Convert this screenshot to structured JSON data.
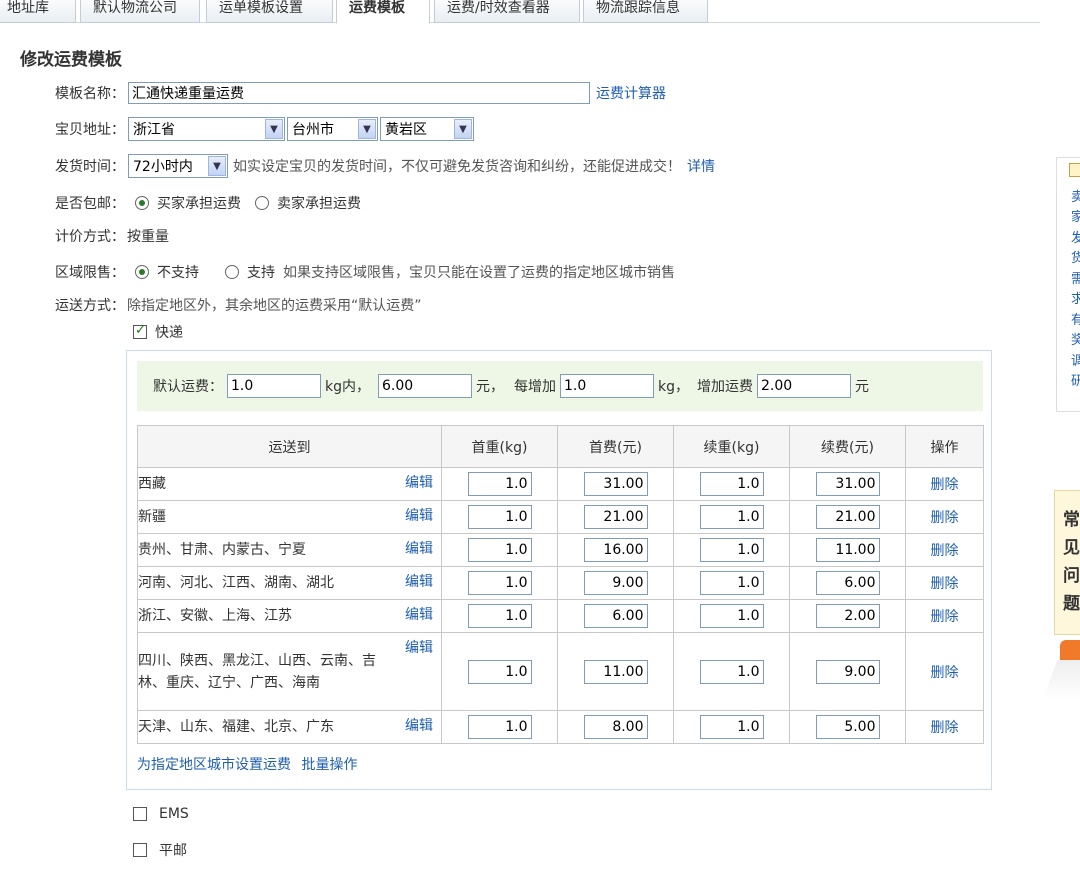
{
  "tabs": [
    "地址库",
    "默认物流公司",
    "运单模板设置",
    "运费模板",
    "运费/时效查看器",
    "物流跟踪信息"
  ],
  "page_title": "修改运费模板",
  "form": {
    "name_label": "模板名称：",
    "name_value": "汇通快递重量运费",
    "calc_link": "运费计算器",
    "address_label": "宝贝地址：",
    "province": "浙江省",
    "city": "台州市",
    "district": "黄岩区",
    "ship_time_label": "发货时间：",
    "ship_time": "72小时内",
    "ship_time_hint": "如实设定宝贝的发货时间，不仅可避免发货咨询和纠纷，还能促进成交！",
    "details_link": "详情",
    "free_ship_label": "是否包邮：",
    "free_ship_options": [
      "买家承担运费",
      "卖家承担运费"
    ],
    "pricing_label": "计价方式：",
    "pricing_value": "按重量",
    "region_label": "区域限售：",
    "region_options": [
      "不支持",
      "支持"
    ],
    "region_hint": "如果支持区域限售，宝贝只能在设置了运费的指定地区城市销售",
    "delivery_label": "运送方式：",
    "delivery_hint": "除指定地区外，其余地区的运费采用“默认运费”"
  },
  "express": {
    "label": "快递",
    "default_fee": {
      "label": "默认运费：",
      "weight": "1.0",
      "weight_unit": "kg内，",
      "fee": "6.00",
      "fee_unit": "元，",
      "per_add_label": "每增加",
      "add_weight": "1.0",
      "add_weight_unit": "kg，",
      "add_fee_label": "增加运费",
      "add_fee": "2.00",
      "add_fee_unit": "元"
    },
    "table": {
      "headers": [
        "运送到",
        "首重(kg)",
        "首费(元)",
        "续重(kg)",
        "续费(元)",
        "操作"
      ],
      "edit_label": "编辑",
      "delete_label": "删除",
      "rows": [
        {
          "dest": "西藏",
          "first_weight": "1.0",
          "first_fee": "31.00",
          "add_weight": "1.0",
          "add_fee": "31.00"
        },
        {
          "dest": "新疆",
          "first_weight": "1.0",
          "first_fee": "21.00",
          "add_weight": "1.0",
          "add_fee": "21.00"
        },
        {
          "dest": "贵州、甘肃、内蒙古、宁夏",
          "first_weight": "1.0",
          "first_fee": "16.00",
          "add_weight": "1.0",
          "add_fee": "11.00"
        },
        {
          "dest": "河南、河北、江西、湖南、湖北",
          "first_weight": "1.0",
          "first_fee": "9.00",
          "add_weight": "1.0",
          "add_fee": "6.00"
        },
        {
          "dest": "浙江、安徽、上海、江苏",
          "first_weight": "1.0",
          "first_fee": "6.00",
          "add_weight": "1.0",
          "add_fee": "2.00"
        },
        {
          "dest": "四川、陕西、黑龙江、山西、云南、吉林、重庆、辽宁、广西、海南",
          "first_weight": "1.0",
          "first_fee": "11.00",
          "add_weight": "1.0",
          "add_fee": "9.00"
        },
        {
          "dest": "天津、山东、福建、北京、广东",
          "first_weight": "1.0",
          "first_fee": "8.00",
          "add_weight": "1.0",
          "add_fee": "5.00"
        }
      ]
    },
    "set_region_link": "为指定地区城市设置运费",
    "batch_link": "批量操作"
  },
  "other_methods": [
    "EMS",
    "平邮"
  ],
  "side_panel_1": [
    "卖",
    "家",
    "发",
    "货",
    "需",
    "求",
    "有",
    "奖",
    "调",
    "研"
  ],
  "side_panel_2": [
    "常",
    "见",
    "问",
    "题"
  ]
}
